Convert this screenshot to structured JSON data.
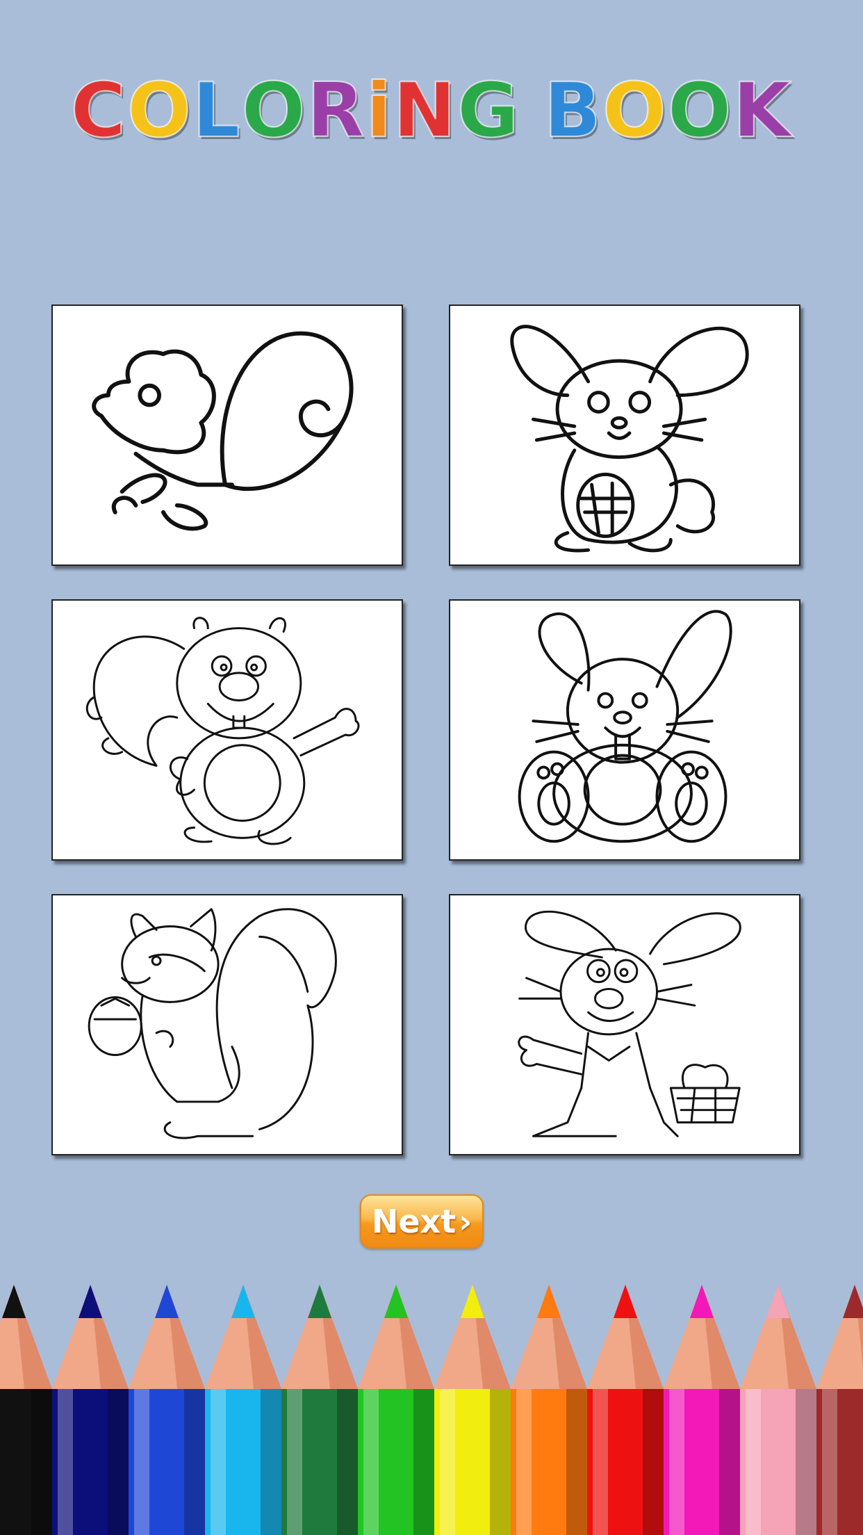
{
  "title": {
    "text": "COLORiNG BOOK",
    "letters": [
      {
        "ch": "C",
        "color": "#e03232"
      },
      {
        "ch": "O",
        "color": "#f5c219"
      },
      {
        "ch": "L",
        "color": "#2e8ad8"
      },
      {
        "ch": "O",
        "color": "#2aa84a"
      },
      {
        "ch": "R",
        "color": "#9a3ea8"
      },
      {
        "ch": "i",
        "color": "#f08a1a"
      },
      {
        "ch": "N",
        "color": "#e03232"
      },
      {
        "ch": "G",
        "color": "#2aa84a"
      },
      {
        "ch": " ",
        "color": "#000000"
      },
      {
        "ch": "B",
        "color": "#2e8ad8"
      },
      {
        "ch": "O",
        "color": "#f5c219"
      },
      {
        "ch": "O",
        "color": "#2aa84a"
      },
      {
        "ch": "K",
        "color": "#9a3ea8"
      }
    ]
  },
  "pages": [
    {
      "name": "squirrel-1-card",
      "subject": "squirrel-icon"
    },
    {
      "name": "bunny-1-card",
      "subject": "bunny-icon"
    },
    {
      "name": "squirrel-2-card",
      "subject": "squirrel-icon"
    },
    {
      "name": "bunny-2-card",
      "subject": "bunny-icon"
    },
    {
      "name": "squirrel-3-card",
      "subject": "squirrel-icon"
    },
    {
      "name": "bunny-3-card",
      "subject": "bunny-icon"
    }
  ],
  "next_button": {
    "label": "Next",
    "chevron": "›"
  },
  "pencil_colors": [
    "#111111",
    "#0c0f7a",
    "#1e47d6",
    "#19b6ee",
    "#1f7a3d",
    "#22c322",
    "#f1ee0f",
    "#ff7a0f",
    "#ee1111",
    "#f219b8",
    "#f5a3b6",
    "#9c2a2a"
  ]
}
